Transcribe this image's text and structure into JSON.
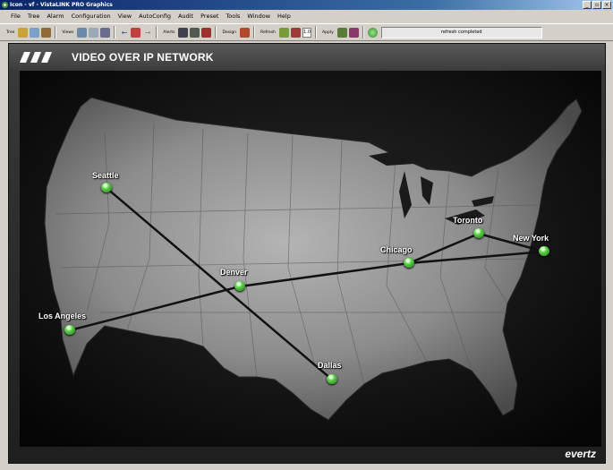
{
  "window": {
    "title": "Icon - vf - VistaLINK PRO Graphics",
    "controls": [
      "minimize",
      "restore",
      "close"
    ]
  },
  "menu": [
    "File",
    "Tree",
    "Alarm",
    "Configuration",
    "View",
    "AutoConfig",
    "Audit",
    "Preset",
    "Tools",
    "Window",
    "Help"
  ],
  "toolbar": {
    "tree_label": "Tree",
    "views_label": "Views",
    "alerts_label": "Alerts",
    "design_label": "Design",
    "refresh_label": "Refresh",
    "zoom_value": "1.0",
    "apply_label": "Apply",
    "status_text": "refresh completed"
  },
  "panel": {
    "title": "VIDEO OVER IP NETWORK",
    "brand": "evertz"
  },
  "cities": {
    "seattle": "Seattle",
    "los_angeles": "Los Angeles",
    "denver": "Denver",
    "dallas": "Dallas",
    "chicago": "Chicago",
    "toronto": "Toronto",
    "new_york": "New York"
  },
  "node_status_color": "#5fd04a",
  "accent_colors": {
    "title_bar": "#0a246a",
    "map_background": "#1a1a1a",
    "land": "#8a8a8a"
  }
}
